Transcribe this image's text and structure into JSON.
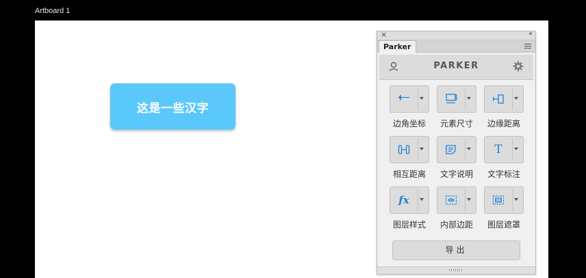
{
  "artboard": {
    "title": "Artboard 1"
  },
  "canvas": {
    "button_text": "这是一些汉字"
  },
  "panel": {
    "tab_label": "Parker",
    "brand": "PARKER",
    "tools": [
      {
        "label": "边角坐标",
        "icon": "corner-coordinate-icon"
      },
      {
        "label": "元素尺寸",
        "icon": "element-size-icon"
      },
      {
        "label": "边缘距离",
        "icon": "edge-distance-icon"
      },
      {
        "label": "相互距离",
        "icon": "mutual-distance-icon"
      },
      {
        "label": "文字说明",
        "icon": "text-note-icon"
      },
      {
        "label": "文字标注",
        "icon": "text-annotation-icon"
      },
      {
        "label": "图层样式",
        "icon": "layer-style-icon"
      },
      {
        "label": "内部边距",
        "icon": "inner-padding-icon"
      },
      {
        "label": "图层遮罩",
        "icon": "layer-mask-icon"
      }
    ],
    "export_label": "导出",
    "fx_symbol": "fx",
    "text_symbol": "T"
  },
  "colors": {
    "accent_blue": "#5ac8fa",
    "icon_blue": "#1f7fd6"
  }
}
